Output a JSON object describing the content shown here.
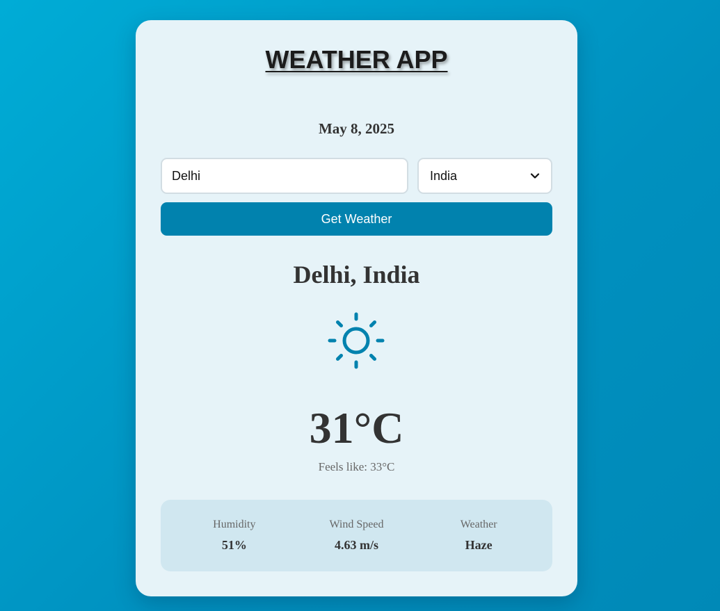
{
  "header": {
    "title": "WEATHER APP"
  },
  "date": "May 8, 2025",
  "search": {
    "city_value": "Delhi",
    "country_selected": "India",
    "button_label": "Get Weather"
  },
  "result": {
    "location": "Delhi, India",
    "icon": "sun-icon",
    "temperature": "31°C",
    "feels_like": "Feels like: 33°C"
  },
  "details": [
    {
      "label": "Humidity",
      "value": "51%"
    },
    {
      "label": "Wind Speed",
      "value": "4.63 m/s"
    },
    {
      "label": "Weather",
      "value": "Haze"
    }
  ],
  "colors": {
    "accent": "#0182ae",
    "card_background": "#e6f3f8",
    "details_background": "#d0e7f0"
  }
}
